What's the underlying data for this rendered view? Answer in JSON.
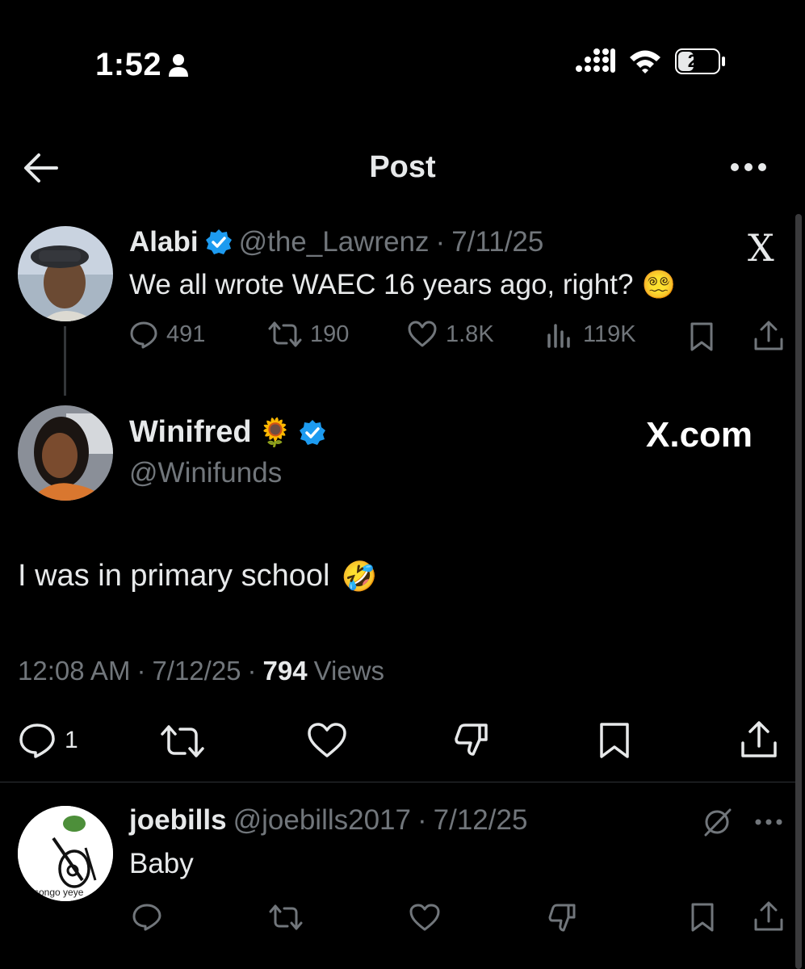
{
  "status_bar": {
    "time": "1:52",
    "battery": "26",
    "battery_level": 0.26,
    "icons": [
      "person-icon",
      "cellular-signal-icon",
      "wifi-icon",
      "battery-icon"
    ]
  },
  "header": {
    "title": "Post",
    "icons": [
      "back-arrow-icon",
      "more-options-icon"
    ]
  },
  "quoted_tweet": {
    "name": "Alabi",
    "handle": "@the_Lawrenz",
    "separator": "·",
    "date": "7/11/25",
    "text": "We all wrote WAEC 16 years ago, right?",
    "emoji": "😵‍💫",
    "watermark": "X",
    "metrics": {
      "replies": "491",
      "reposts": "190",
      "likes": "1.8K",
      "views": "119K"
    }
  },
  "main_tweet": {
    "name": "Winifred",
    "name_emoji": "🌻",
    "handle": "@Winifunds",
    "watermark": "X.com",
    "text": "I was in primary school",
    "emoji": "🤣",
    "time": "12:08 AM",
    "separator": "·",
    "date": "7/12/25",
    "views_count": "794",
    "views_label": "Views",
    "actions": {
      "reply_count": "1"
    }
  },
  "reply_tweet": {
    "name": "joebills",
    "handle": "@joebills2017",
    "separator": "·",
    "date": "7/12/25",
    "text": "Baby",
    "avatar_caption": "songo yeye"
  },
  "colors": {
    "background": "#000000",
    "text_primary": "#e7e9ea",
    "text_secondary": "#71767b",
    "verified": "#1d9bf0",
    "divider": "#2f3336"
  }
}
